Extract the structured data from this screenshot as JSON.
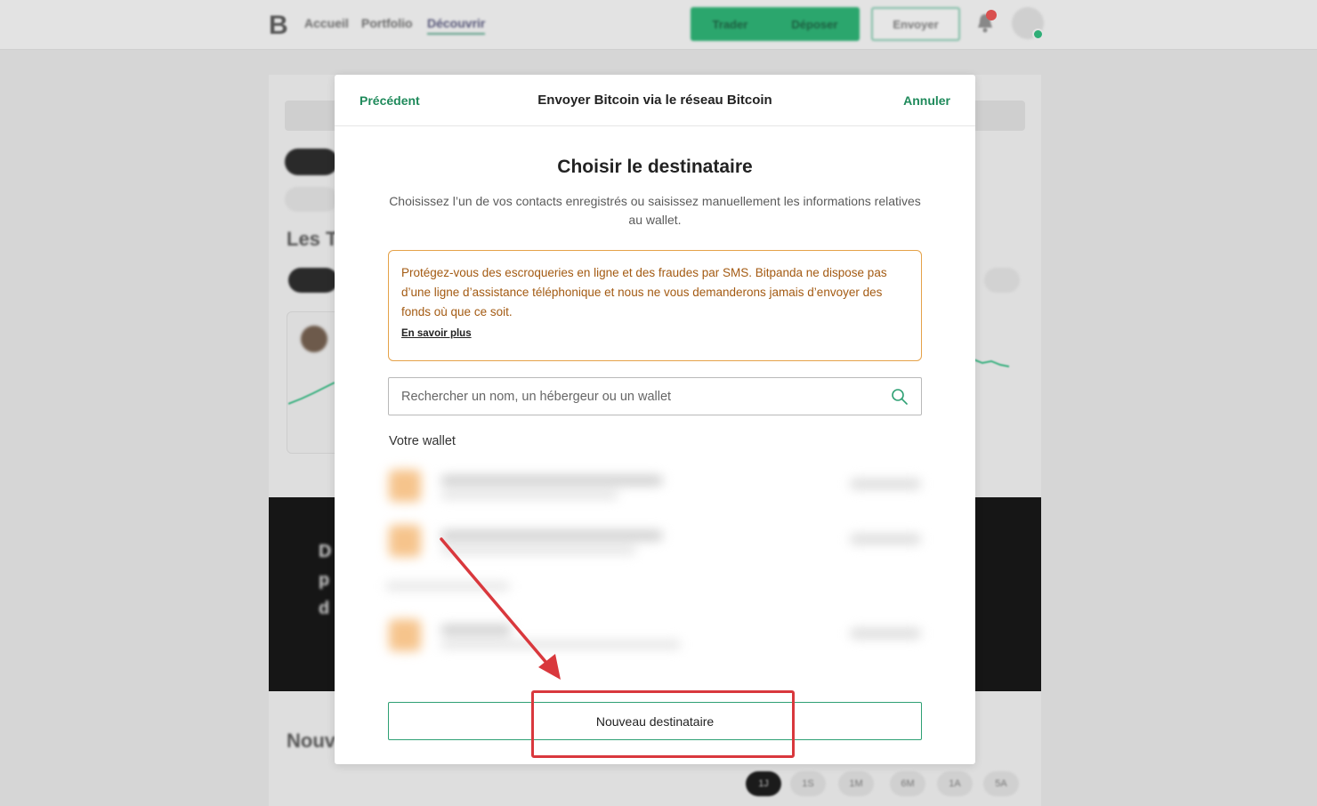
{
  "background_app": {
    "nav": {
      "logo": "B",
      "links": [
        "Accueil",
        "Portfolio",
        "Découvrir"
      ],
      "active_link": "Découvrir",
      "trade_button": "Trader",
      "deposit_button": "Déposer",
      "send_button": "Envoyer"
    },
    "range_pills": [
      "1J",
      "1S",
      "1M",
      "6M",
      "1A",
      "5A"
    ],
    "active_range": "1J"
  },
  "modal": {
    "header": {
      "back_label": "Précédent",
      "title": "Envoyer Bitcoin via le réseau Bitcoin",
      "cancel_label": "Annuler"
    },
    "title": "Choisir le destinataire",
    "subtitle": "Choisissez l’un de vos contacts enregistrés ou saisissez manuellement les informations relatives au wallet.",
    "warning": {
      "text": "Protégez-vous des escroqueries en ligne et des fraudes par SMS. Bitpanda ne dispose pas d’une ligne d’assistance téléphonique et nous ne vous demanderons jamais d’envoyer des fonds où que ce soit.",
      "link_label": "En savoir plus"
    },
    "search": {
      "placeholder": "Rechercher un nom, un hébergeur ou un wallet"
    },
    "wallet_section_label": "Votre wallet",
    "new_recipient_button": "Nouveau destinataire"
  },
  "colors": {
    "accent_green": "#1f8a5b",
    "warning_border": "#e5a249",
    "warning_text": "#a35a12",
    "annotation_red": "#d9383d"
  }
}
